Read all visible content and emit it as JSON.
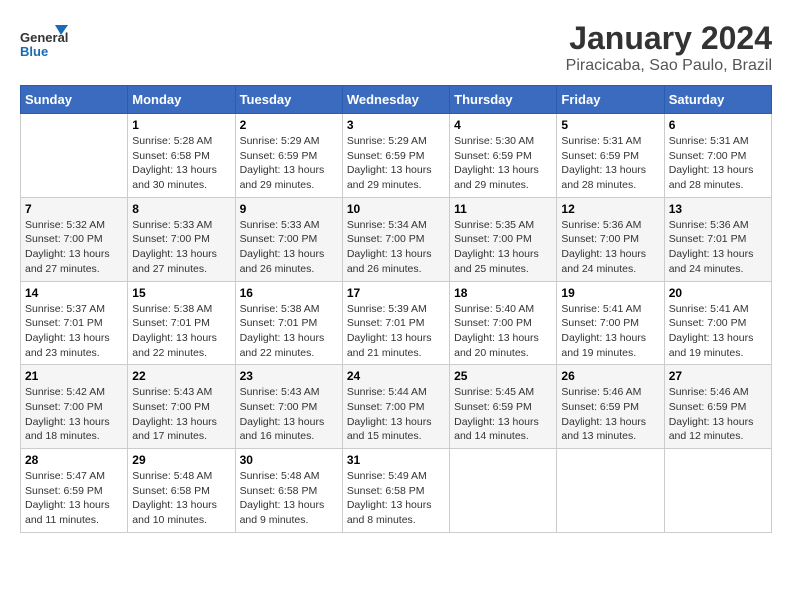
{
  "header": {
    "logo_general": "General",
    "logo_blue": "Blue",
    "main_title": "January 2024",
    "subtitle": "Piracicaba, Sao Paulo, Brazil"
  },
  "days_of_week": [
    "Sunday",
    "Monday",
    "Tuesday",
    "Wednesday",
    "Thursday",
    "Friday",
    "Saturday"
  ],
  "weeks": [
    [
      {
        "day": "",
        "info": ""
      },
      {
        "day": "1",
        "info": "Sunrise: 5:28 AM\nSunset: 6:58 PM\nDaylight: 13 hours\nand 30 minutes."
      },
      {
        "day": "2",
        "info": "Sunrise: 5:29 AM\nSunset: 6:59 PM\nDaylight: 13 hours\nand 29 minutes."
      },
      {
        "day": "3",
        "info": "Sunrise: 5:29 AM\nSunset: 6:59 PM\nDaylight: 13 hours\nand 29 minutes."
      },
      {
        "day": "4",
        "info": "Sunrise: 5:30 AM\nSunset: 6:59 PM\nDaylight: 13 hours\nand 29 minutes."
      },
      {
        "day": "5",
        "info": "Sunrise: 5:31 AM\nSunset: 6:59 PM\nDaylight: 13 hours\nand 28 minutes."
      },
      {
        "day": "6",
        "info": "Sunrise: 5:31 AM\nSunset: 7:00 PM\nDaylight: 13 hours\nand 28 minutes."
      }
    ],
    [
      {
        "day": "7",
        "info": "Sunrise: 5:32 AM\nSunset: 7:00 PM\nDaylight: 13 hours\nand 27 minutes."
      },
      {
        "day": "8",
        "info": "Sunrise: 5:33 AM\nSunset: 7:00 PM\nDaylight: 13 hours\nand 27 minutes."
      },
      {
        "day": "9",
        "info": "Sunrise: 5:33 AM\nSunset: 7:00 PM\nDaylight: 13 hours\nand 26 minutes."
      },
      {
        "day": "10",
        "info": "Sunrise: 5:34 AM\nSunset: 7:00 PM\nDaylight: 13 hours\nand 26 minutes."
      },
      {
        "day": "11",
        "info": "Sunrise: 5:35 AM\nSunset: 7:00 PM\nDaylight: 13 hours\nand 25 minutes."
      },
      {
        "day": "12",
        "info": "Sunrise: 5:36 AM\nSunset: 7:00 PM\nDaylight: 13 hours\nand 24 minutes."
      },
      {
        "day": "13",
        "info": "Sunrise: 5:36 AM\nSunset: 7:01 PM\nDaylight: 13 hours\nand 24 minutes."
      }
    ],
    [
      {
        "day": "14",
        "info": "Sunrise: 5:37 AM\nSunset: 7:01 PM\nDaylight: 13 hours\nand 23 minutes."
      },
      {
        "day": "15",
        "info": "Sunrise: 5:38 AM\nSunset: 7:01 PM\nDaylight: 13 hours\nand 22 minutes."
      },
      {
        "day": "16",
        "info": "Sunrise: 5:38 AM\nSunset: 7:01 PM\nDaylight: 13 hours\nand 22 minutes."
      },
      {
        "day": "17",
        "info": "Sunrise: 5:39 AM\nSunset: 7:01 PM\nDaylight: 13 hours\nand 21 minutes."
      },
      {
        "day": "18",
        "info": "Sunrise: 5:40 AM\nSunset: 7:00 PM\nDaylight: 13 hours\nand 20 minutes."
      },
      {
        "day": "19",
        "info": "Sunrise: 5:41 AM\nSunset: 7:00 PM\nDaylight: 13 hours\nand 19 minutes."
      },
      {
        "day": "20",
        "info": "Sunrise: 5:41 AM\nSunset: 7:00 PM\nDaylight: 13 hours\nand 19 minutes."
      }
    ],
    [
      {
        "day": "21",
        "info": "Sunrise: 5:42 AM\nSunset: 7:00 PM\nDaylight: 13 hours\nand 18 minutes."
      },
      {
        "day": "22",
        "info": "Sunrise: 5:43 AM\nSunset: 7:00 PM\nDaylight: 13 hours\nand 17 minutes."
      },
      {
        "day": "23",
        "info": "Sunrise: 5:43 AM\nSunset: 7:00 PM\nDaylight: 13 hours\nand 16 minutes."
      },
      {
        "day": "24",
        "info": "Sunrise: 5:44 AM\nSunset: 7:00 PM\nDaylight: 13 hours\nand 15 minutes."
      },
      {
        "day": "25",
        "info": "Sunrise: 5:45 AM\nSunset: 6:59 PM\nDaylight: 13 hours\nand 14 minutes."
      },
      {
        "day": "26",
        "info": "Sunrise: 5:46 AM\nSunset: 6:59 PM\nDaylight: 13 hours\nand 13 minutes."
      },
      {
        "day": "27",
        "info": "Sunrise: 5:46 AM\nSunset: 6:59 PM\nDaylight: 13 hours\nand 12 minutes."
      }
    ],
    [
      {
        "day": "28",
        "info": "Sunrise: 5:47 AM\nSunset: 6:59 PM\nDaylight: 13 hours\nand 11 minutes."
      },
      {
        "day": "29",
        "info": "Sunrise: 5:48 AM\nSunset: 6:58 PM\nDaylight: 13 hours\nand 10 minutes."
      },
      {
        "day": "30",
        "info": "Sunrise: 5:48 AM\nSunset: 6:58 PM\nDaylight: 13 hours\nand 9 minutes."
      },
      {
        "day": "31",
        "info": "Sunrise: 5:49 AM\nSunset: 6:58 PM\nDaylight: 13 hours\nand 8 minutes."
      },
      {
        "day": "",
        "info": ""
      },
      {
        "day": "",
        "info": ""
      },
      {
        "day": "",
        "info": ""
      }
    ]
  ]
}
